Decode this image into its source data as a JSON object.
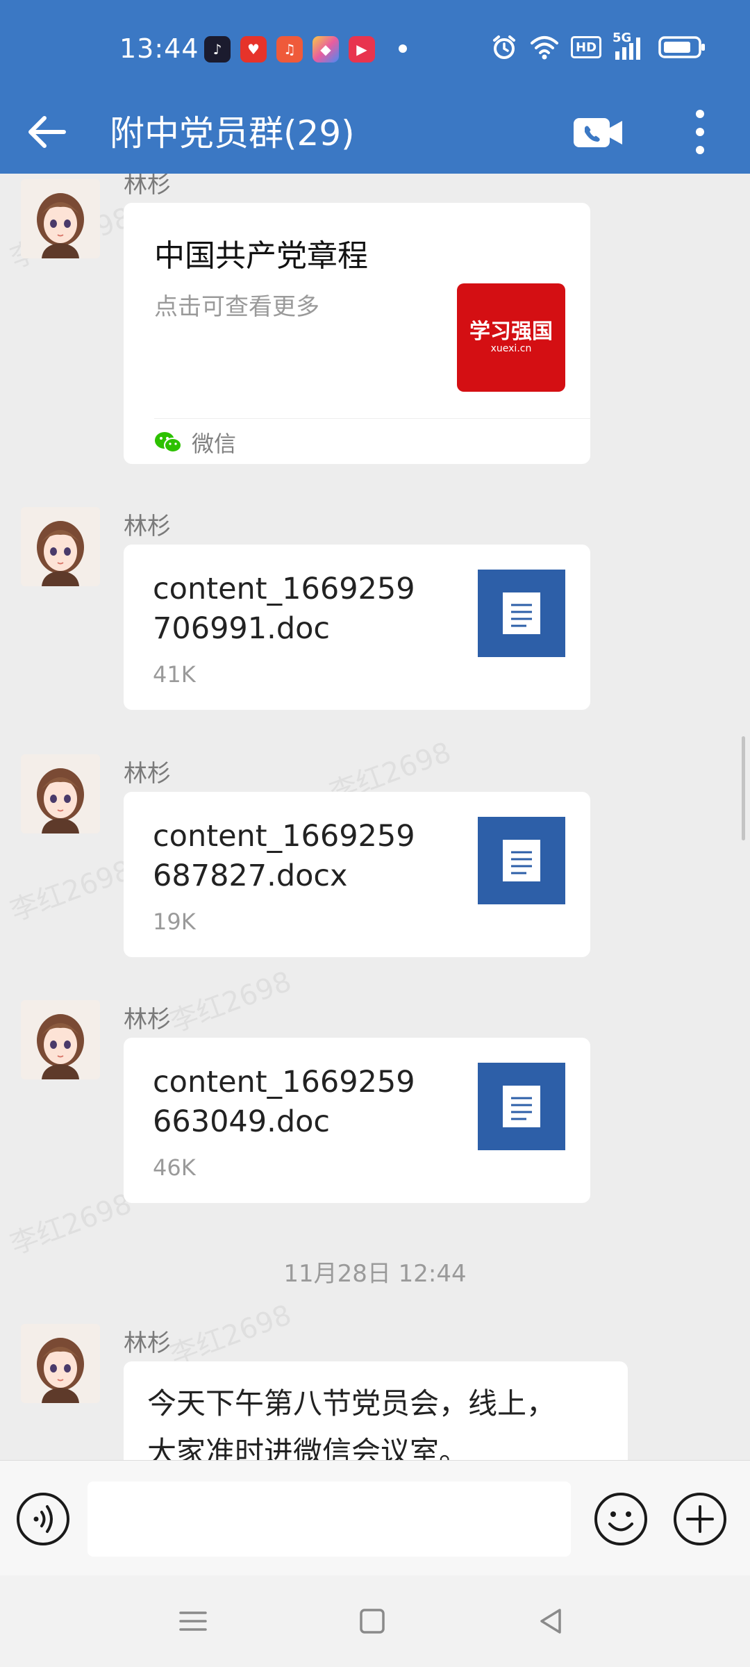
{
  "status_bar": {
    "time": "13:44",
    "signal_label": "5G",
    "hd_label": "HD"
  },
  "header": {
    "title": "附中党员群(29)"
  },
  "watermark_text": "李红2698",
  "messages": [
    {
      "type": "card",
      "sender": "林杉",
      "title": "中国共产党章程",
      "description": "点击可查看更多",
      "source": "微信",
      "thumb_text": "学习强国",
      "thumb_sub": "xuexi.cn"
    },
    {
      "type": "file",
      "sender": "林杉",
      "filename": "content_1669259706991.doc",
      "size": "41K"
    },
    {
      "type": "file",
      "sender": "林杉",
      "filename": "content_1669259687827.docx",
      "size": "19K"
    },
    {
      "type": "file",
      "sender": "林杉",
      "filename": "content_1669259663049.doc",
      "size": "46K"
    },
    {
      "type": "timestamp",
      "text": "11月28日  12:44"
    },
    {
      "type": "text",
      "sender": "林杉",
      "text": "今天下午第八节党员会，线上，大家准时进微信会议室。"
    }
  ],
  "input": {
    "value": "",
    "placeholder": ""
  },
  "colors": {
    "header_bg": "#3b78c4",
    "file_icon_bg": "#2d5fa8",
    "thumb_bg": "#d40f13",
    "chat_bg": "#ededed"
  }
}
